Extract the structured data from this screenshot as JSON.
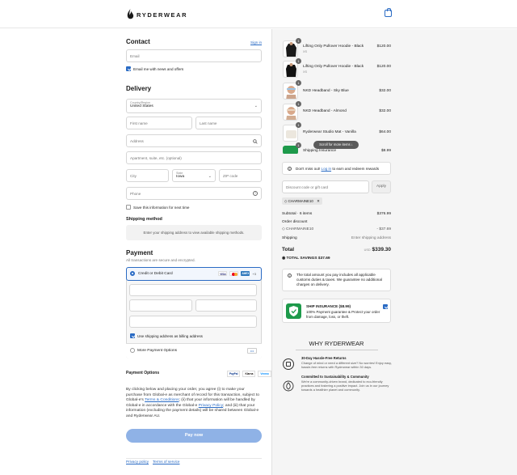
{
  "brand": {
    "name": "RYDERWEAR"
  },
  "contact": {
    "title": "Contact",
    "sign_in": "Sign in",
    "email_placeholder": "Email",
    "newsletter_label": "Email me with news and offers"
  },
  "delivery": {
    "title": "Delivery",
    "country_label": "Country/Region",
    "country_value": "United States",
    "first_name": "First name",
    "last_name": "Last name",
    "address": "Address",
    "apartment": "Apartment, suite, etc. (optional)",
    "city": "City",
    "state_label": "State",
    "state_value": "Iowa",
    "zip": "ZIP code",
    "phone": "Phone",
    "save_info": "Save this information for next time"
  },
  "shipping": {
    "title": "Shipping method",
    "placeholder": "Enter your shipping address to view available shipping methods."
  },
  "payment": {
    "title": "Payment",
    "subtitle": "All transactions are secure and encrypted.",
    "credit_label": "Credit or Debit Card",
    "more_cards": "+3",
    "card_brands": [
      "VISA",
      "MC",
      "AMEX"
    ],
    "billing_label": "Use shipping address as billing address",
    "more_options": "More Payment Options",
    "more_dots": "•••"
  },
  "payment_options": {
    "title": "Payment Options",
    "logos": [
      "PayPal",
      "Klarna",
      "Venmo"
    ]
  },
  "legal": {
    "part1": "By clicking below and placing your order, you agree (i) to make your purchase from Global-e as merchant of record for this transaction, subject to Global-e's ",
    "terms_link": "Terms & Conditions",
    "part2": "; (ii) that your information will be handled by Global-e in accordance with the Global-e ",
    "privacy_link": "Privacy Policy",
    "part3": "; and (iii) that your information (excluding the payment details) will be shared between Global-e and Ryderwear AU."
  },
  "pay_button": "Pay now",
  "footer": {
    "privacy": "Privacy policy",
    "terms": "Terms of service"
  },
  "cart": {
    "items": [
      {
        "name": "Lifting Only Pullover Hoodie - Black",
        "variant": "XS",
        "price": "$120.00",
        "qty": "1"
      },
      {
        "name": "Lifting Only Pullover Hoodie - Black",
        "variant": "XS",
        "price": "$120.00",
        "qty": "1"
      },
      {
        "name": "NKD Headband - Sky Blue",
        "variant": "",
        "price": "$32.00",
        "qty": "1"
      },
      {
        "name": "NKD Headband - Almond",
        "variant": "",
        "price": "$32.00",
        "qty": "1"
      },
      {
        "name": "Ryderwear Studio Mat - Vanilla",
        "variant": "",
        "price": "$64.00",
        "qty": "1"
      },
      {
        "name": "Shipping Insurance",
        "variant": "",
        "price": "$8.99",
        "qty": "1"
      }
    ],
    "scroll_hint": "Scroll for more items",
    "login_prompt_pre": "Don't miss out! ",
    "login_link": "Log in",
    "login_prompt_post": " to earn and redeem rewards",
    "discount_placeholder": "Discount code or gift card",
    "apply": "Apply",
    "applied_code": "CHARMAINE10",
    "subtotal_label": "Subtotal · 6 items",
    "subtotal": "$376.99",
    "order_discount_label": "Order discount",
    "discount_code": "CHARMAINE10",
    "discount_value": "- $37.69",
    "shipping_label": "Shipping",
    "shipping_value": "Enter shipping address",
    "total_label": "Total",
    "currency": "USD",
    "total": "$339.30",
    "savings_label": "TOTAL SAVINGS",
    "savings": "$37.69",
    "duties_note": "The total amount you pay includes all applicable customs duties & taxes. We guarantee no additional charges on delivery.",
    "insurance_title": "SHIP INSURANCE ($8.99)",
    "insurance_text": "100% Payment guarantee & Protect your order from damage, loss, or theft."
  },
  "why": {
    "title": "WHY RYDERWEAR",
    "items": [
      {
        "title": "30-Day Hassle-Free Returns",
        "text": "Change of mind or need a different size? No worries! Enjoy easy, hassle-free returns with Ryderwear within 30 days."
      },
      {
        "title": "Committed to Sustainability & Community",
        "text": "We're a community-driven brand, dedicated to eco-friendly practices and fostering a positive impact. Join us in our journey towards a healthier planet and community."
      }
    ]
  },
  "colors": {
    "accent": "#2a6bc4",
    "pay_button": "#8fb2e6",
    "insurance_green": "#1e9a4b"
  }
}
